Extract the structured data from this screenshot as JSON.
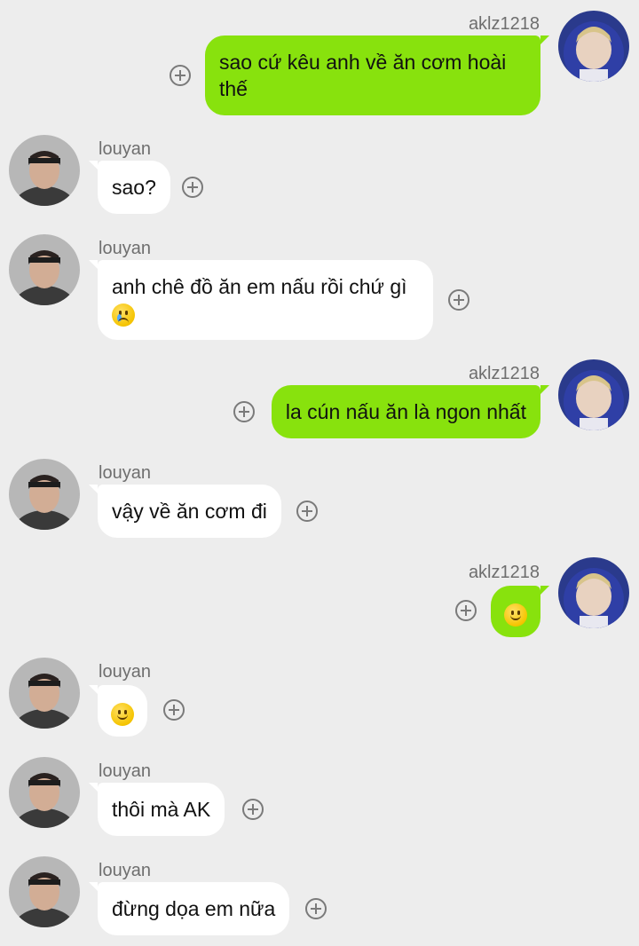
{
  "chat": {
    "messages": [
      {
        "sender": "aklz1218",
        "side": "right",
        "text": "sao cứ kêu anh về ăn cơm hoài thế"
      },
      {
        "sender": "louyan",
        "side": "left",
        "text": "sao?"
      },
      {
        "sender": "louyan",
        "side": "left",
        "text": "anh chê đồ ăn em nấu rồi chứ gì",
        "emoji": "crying-face-emoji"
      },
      {
        "sender": "aklz1218",
        "side": "right",
        "text": "la cún nấu ăn là ngon nhất"
      },
      {
        "sender": "louyan",
        "side": "left",
        "text": "vậy về ăn cơm đi"
      },
      {
        "sender": "aklz1218",
        "side": "right",
        "emoji": "slightly-smiling-face-emoji"
      },
      {
        "sender": "louyan",
        "side": "left",
        "emoji": "slightly-smiling-face-emoji"
      },
      {
        "sender": "louyan",
        "side": "left",
        "text": "thôi mà AK"
      },
      {
        "sender": "louyan",
        "side": "left",
        "text": "đừng dọa em nữa"
      }
    ]
  },
  "colors": {
    "background": "#ededed",
    "outgoing_bubble": "#88e20d",
    "incoming_bubble": "#ffffff",
    "name_text": "#6e6e6e"
  }
}
